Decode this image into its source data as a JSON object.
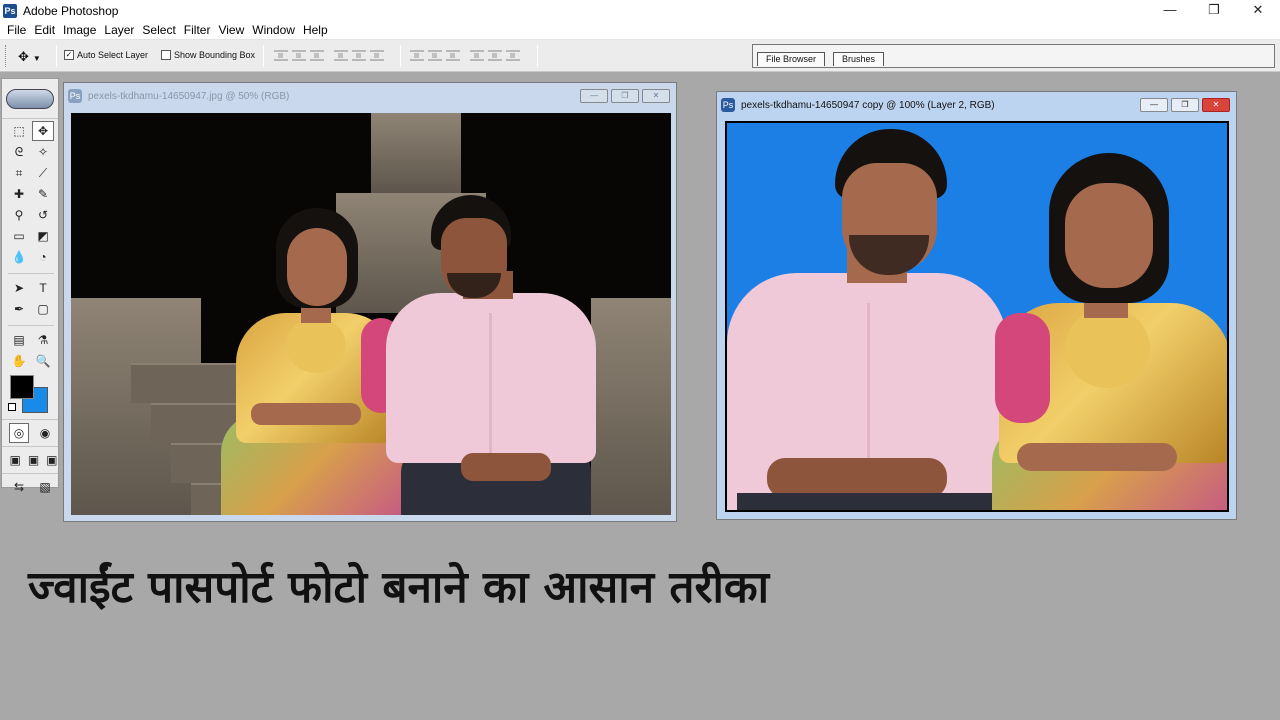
{
  "app": {
    "title": "Adobe Photoshop"
  },
  "window_controls": {
    "minimize": "—",
    "restore": "❐",
    "close": "✕"
  },
  "menu": [
    "File",
    "Edit",
    "Image",
    "Layer",
    "Select",
    "Filter",
    "View",
    "Window",
    "Help"
  ],
  "options_bar": {
    "tool_icon": "move-tool-icon",
    "auto_select_label": "Auto Select Layer",
    "auto_select_checked": true,
    "show_bbox_label": "Show Bounding Box",
    "show_bbox_checked": false,
    "palette_tabs": [
      "File Browser",
      "Brushes"
    ]
  },
  "toolbox": {
    "tools": [
      {
        "icon": "marquee-icon",
        "glyph": "⬚"
      },
      {
        "icon": "move-icon",
        "glyph": "✥"
      },
      {
        "icon": "lasso-icon",
        "glyph": "ᘓ"
      },
      {
        "icon": "magic-wand-icon",
        "glyph": "✧"
      },
      {
        "icon": "crop-icon",
        "glyph": "⌗"
      },
      {
        "icon": "slice-icon",
        "glyph": "⟋"
      },
      {
        "icon": "healing-brush-icon",
        "glyph": "✚"
      },
      {
        "icon": "brush-icon",
        "glyph": "✎"
      },
      {
        "icon": "clone-stamp-icon",
        "glyph": "⚲"
      },
      {
        "icon": "history-brush-icon",
        "glyph": "↺"
      },
      {
        "icon": "eraser-icon",
        "glyph": "▭"
      },
      {
        "icon": "gradient-icon",
        "glyph": "◩"
      },
      {
        "icon": "blur-icon",
        "glyph": "💧"
      },
      {
        "icon": "dodge-icon",
        "glyph": "◔"
      },
      {
        "icon": "path-select-icon",
        "glyph": "➤"
      },
      {
        "icon": "type-icon",
        "glyph": "T"
      },
      {
        "icon": "pen-icon",
        "glyph": "✒"
      },
      {
        "icon": "shape-icon",
        "glyph": "▢"
      },
      {
        "icon": "notes-icon",
        "glyph": "▤"
      },
      {
        "icon": "eyedropper-icon",
        "glyph": "⚗"
      },
      {
        "icon": "hand-icon",
        "glyph": "✋"
      },
      {
        "icon": "zoom-icon",
        "glyph": "🔍"
      }
    ],
    "foreground_color": "#000000",
    "background_color": "#1a8ae8"
  },
  "documents": [
    {
      "title": "pexels-tkdhamu-14650947.jpg @ 50% (RGB)",
      "active": false,
      "buttons": [
        "—",
        "❐",
        "✕"
      ]
    },
    {
      "title": "pexels-tkdhamu-14650947 copy @ 100% (Layer 2, RGB)",
      "active": true,
      "buttons": [
        "—",
        "❐",
        "✕"
      ],
      "canvas_background": "#1b7fe6"
    }
  ],
  "headline": "ज्वाईंट पासपोर्ट फोटो बनाने का आसान तरीका"
}
